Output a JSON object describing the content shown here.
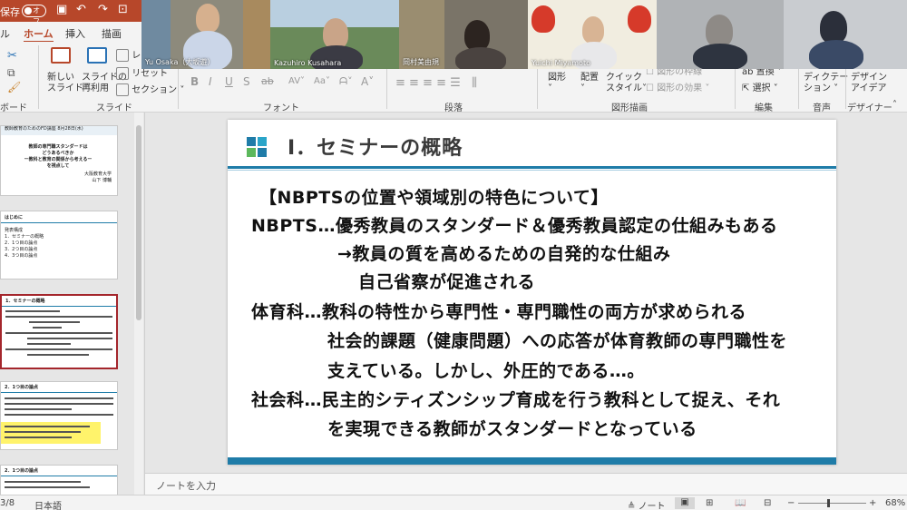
{
  "titlebar": {
    "save_label": "保存",
    "autosave": "オフ"
  },
  "ribbon_tabs": [
    "ホーム",
    "挿入",
    "描画"
  ],
  "ribbon": {
    "clipboard_partial": "ボード",
    "new_slide": [
      "新しい",
      "スライド"
    ],
    "reuse_slide": [
      "スライドの",
      "再利用"
    ],
    "layout_partial": "レ",
    "reset": "リセット",
    "section": "セクション",
    "slides_group": "スライド",
    "font_group": "フォント",
    "paragraph_group": "段落",
    "shape": "図形",
    "arrange": "配置",
    "quick_style": [
      "クイック",
      "スタイル"
    ],
    "shape_effects": "図形の効果",
    "shape_outline_partial": "図形の枠線",
    "drawing_group": "図形描画",
    "select": "選択",
    "replace_partial": "置換",
    "editing_group": "編集",
    "dictation": [
      "ディクテー",
      "ション"
    ],
    "voice_group": "音声",
    "design_ideas": [
      "デザイン",
      "アイデア"
    ],
    "designer_group": "デザイナー"
  },
  "videos": [
    {
      "name": "Yu Osaka（大坂遊）"
    },
    {
      "name": "Kazuhiro Kusahara"
    },
    {
      "name": "岡村美由規"
    },
    {
      "name": "Yuichi Miyamoto"
    }
  ],
  "thumbnails": {
    "t1": [
      "教師の専門職スタンダードは",
      "どうあるべきか",
      "ー教科と教育の関係から考えるー",
      "を視点して",
      "大阪教育大学",
      "山下 博輔"
    ],
    "t1_header": "教師教育のためのFD講座 8月28日(水)",
    "t2_title": "はじめに",
    "t2_items": [
      "発表構成",
      "1．セミナーの概略",
      "2．1つ目の論点",
      "3．2つ目の論点",
      "4．3つ目の論点"
    ],
    "t3_title": "1．セミナーの概略",
    "t4_title": "2．1つ目の論点",
    "t5_title": "2．1つ目の論点"
  },
  "slide": {
    "title": "Ⅰ．セミナーの概略",
    "lines": [
      "【NBPTSの位置や領域別の特色について】",
      "NBPTS…優秀教員のスタンダード＆優秀教員認定の仕組みもある",
      "→教員の質を高めるための自発的な仕組み",
      "自己省察が促進される",
      "体育科…教科の特性から専門性・専門職性の両方が求められる",
      "社会的課題（健康問題）への応答が体育教師の専門職性を",
      "支えている。しかし、外圧的である…。",
      "社会科…民主的シティズンシップ育成を行う教科として捉え、それ",
      "を実現できる教師がスタンダードとなっている"
    ]
  },
  "notes_placeholder": "ノートを入力",
  "status": {
    "slide_no": "3/8",
    "language": "日本語",
    "notes_label": "ノート",
    "zoom": "68%"
  },
  "colors": {
    "accent": "#b7472a",
    "slide_blue": "#1f7ca8",
    "selection": "#a4262c"
  }
}
